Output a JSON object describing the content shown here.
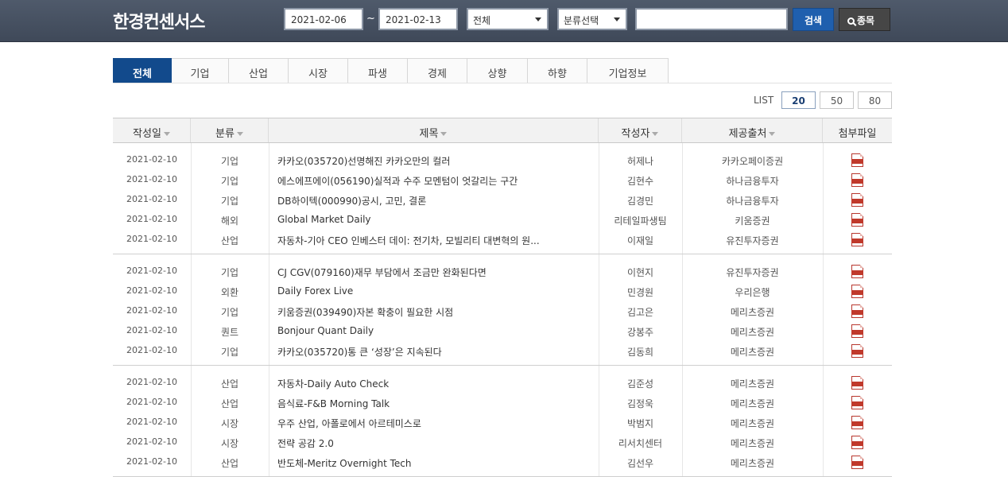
{
  "header": {
    "logo": "한경컨센서스",
    "date_from": "2021-02-06",
    "tilde": "~",
    "date_to": "2021-02-13",
    "select_scope": "전체",
    "select_category": "분류선택",
    "search_button": "검색",
    "stock_button": "종목"
  },
  "tabs": [
    "전체",
    "기업",
    "산업",
    "시장",
    "파생",
    "경제",
    "상향",
    "하향",
    "기업정보"
  ],
  "list": {
    "label": "LIST",
    "sizes": [
      "20",
      "50",
      "80"
    ],
    "active_size": "20"
  },
  "table": {
    "columns": [
      "작성일",
      "분류",
      "제목",
      "작성자",
      "제공출처",
      "첨부파일"
    ],
    "rows": [
      {
        "date": "2021-02-10",
        "category": "기업",
        "title": "카카오(035720)선명해진 카카오만의 컬러",
        "author": "허제나",
        "source": "카카오페이증권"
      },
      {
        "date": "2021-02-10",
        "category": "기업",
        "title": "에스에프에이(056190)실적과 수주 모멘텀이 엇갈리는 구간",
        "author": "김현수",
        "source": "하나금융투자"
      },
      {
        "date": "2021-02-10",
        "category": "기업",
        "title": "DB하이텍(000990)공시, 고민, 결론",
        "author": "김경민",
        "source": "하나금융투자"
      },
      {
        "date": "2021-02-10",
        "category": "해외",
        "title": "Global Market Daily",
        "author": "리테일파생팀",
        "source": "키움증권"
      },
      {
        "date": "2021-02-10",
        "category": "산업",
        "title": "자동차-기아 CEO 인베스터 데이: 전기차, 모빌리티 대변혁의 원...",
        "author": "이재일",
        "source": "유진투자증권"
      },
      {
        "date": "2021-02-10",
        "category": "기업",
        "title": "CJ CGV(079160)재무 부담에서 조금만 완화된다면",
        "author": "이현지",
        "source": "유진투자증권"
      },
      {
        "date": "2021-02-10",
        "category": "외환",
        "title": "Daily Forex Live",
        "author": "민경원",
        "source": "우리은행"
      },
      {
        "date": "2021-02-10",
        "category": "기업",
        "title": "키움증권(039490)자본 확충이 필요한 시점",
        "author": "김고은",
        "source": "메리츠증권"
      },
      {
        "date": "2021-02-10",
        "category": "퀀트",
        "title": "Bonjour Quant Daily",
        "author": "강봉주",
        "source": "메리츠증권"
      },
      {
        "date": "2021-02-10",
        "category": "기업",
        "title": "카카오(035720)통 큰 ‘성장’은 지속된다",
        "author": "김동희",
        "source": "메리츠증권"
      },
      {
        "date": "2021-02-10",
        "category": "산업",
        "title": "자동차-Daily Auto Check",
        "author": "김준성",
        "source": "메리츠증권"
      },
      {
        "date": "2021-02-10",
        "category": "산업",
        "title": "음식료-F&B Morning Talk",
        "author": "김정욱",
        "source": "메리츠증권"
      },
      {
        "date": "2021-02-10",
        "category": "시장",
        "title": "우주 산업, 아폴로에서 아르테미스로",
        "author": "박범지",
        "source": "메리츠증권"
      },
      {
        "date": "2021-02-10",
        "category": "시장",
        "title": "전략 공감 2.0",
        "author": "리서치센터",
        "source": "메리츠증권"
      },
      {
        "date": "2021-02-10",
        "category": "산업",
        "title": "반도체-Meritz Overnight Tech",
        "author": "김선우",
        "source": "메리츠증권"
      }
    ]
  },
  "icons": {
    "pdf": "pdf-file-icon",
    "search": "search-icon",
    "dropdown": "chevron-down-icon"
  },
  "colors": {
    "header_bg": "#46505f",
    "tab_active": "#124a8c",
    "search_button": "#1f5fae",
    "pdf": "#c0392b"
  }
}
